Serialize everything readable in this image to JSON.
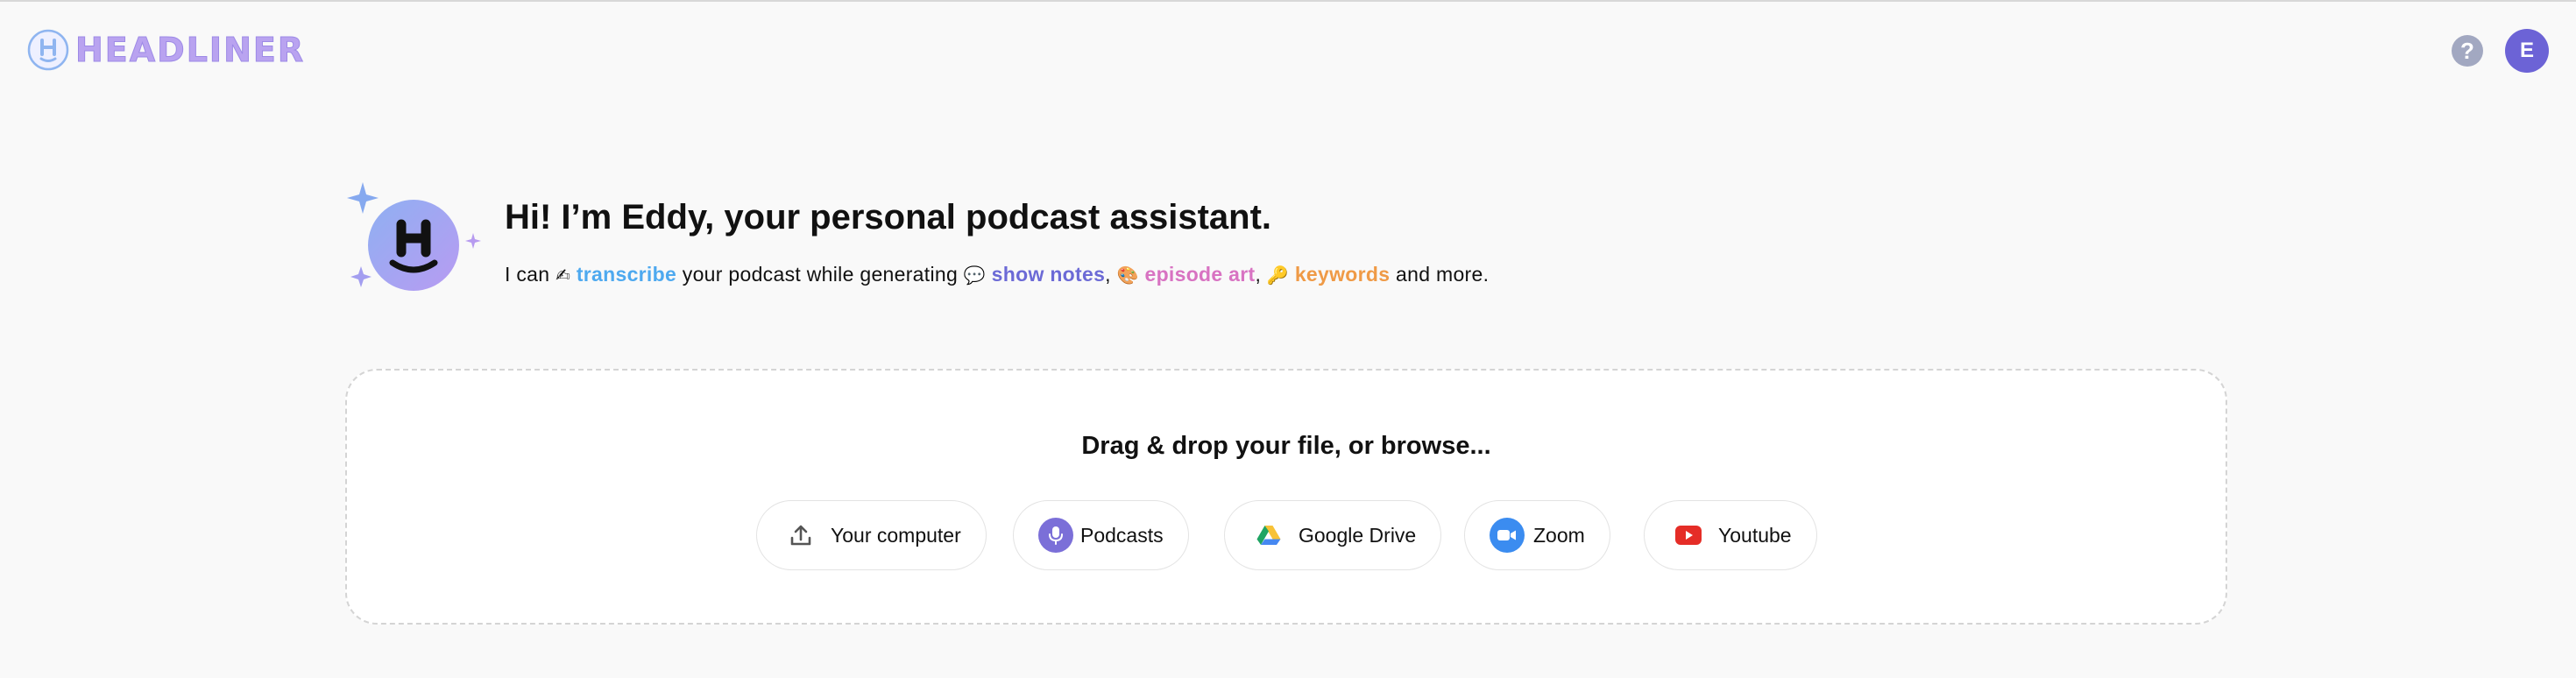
{
  "header": {
    "logo_text": "HEADLINER",
    "help_icon_label": "?",
    "avatar_initial": "E"
  },
  "hero": {
    "title": "Hi! I’m Eddy, your personal podcast assistant.",
    "sub": {
      "prefix": "I can",
      "transcribe_emoji": "✍",
      "transcribe": "transcribe",
      "middle": "your podcast while generating",
      "show_notes_emoji": "💬",
      "show_notes": "show notes",
      "comma1": ",",
      "episode_art_emoji": "🎨",
      "episode_art": "episode art",
      "comma2": ",",
      "keywords_emoji": "🔑",
      "keywords": "keywords",
      "suffix": "and more."
    }
  },
  "upload": {
    "title": "Drag & drop your file, or browse...",
    "sources": [
      {
        "label": "Your computer",
        "icon": "upload-icon"
      },
      {
        "label": "Podcasts",
        "icon": "microphone-icon"
      },
      {
        "label": "Google Drive",
        "icon": "google-drive-icon"
      },
      {
        "label": "Zoom",
        "icon": "zoom-icon"
      },
      {
        "label": "Youtube",
        "icon": "youtube-icon"
      }
    ]
  },
  "colors": {
    "accent_purple": "#6c63d6",
    "transcribe_blue": "#4ea9ef",
    "show_notes_purple": "#6c6ad6",
    "episode_art_pink": "#d873c2",
    "keywords_orange": "#ef9a46",
    "podcasts_icon_bg": "#7b6fd8",
    "zoom_icon_bg": "#3b8cf0",
    "youtube_red": "#e52d27"
  }
}
